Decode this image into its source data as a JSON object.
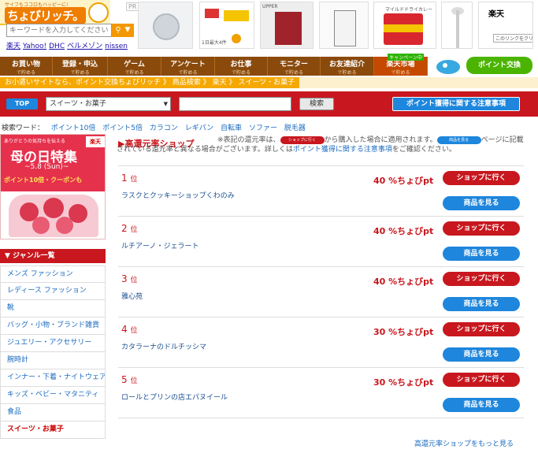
{
  "header": {
    "tagline": "サイフもココロもハッピーに!",
    "brand": "ちょびリッチ。",
    "pr_badge": "PR",
    "search_placeholder": "キーワードを入力してください",
    "quick_links": [
      "楽天",
      "Yahoo!",
      "DHC",
      "ベルメゾン",
      "nissen"
    ],
    "banners": {
      "news_caption": "1日最大4件",
      "shirt_caption": "UPPER",
      "can_caption": "マイルドドライカレー",
      "rakuten_caption": "楽天",
      "rakuten_button": "このリンクをクリック"
    }
  },
  "nav": {
    "items": [
      {
        "label": "お買い物",
        "sub": "で貯める"
      },
      {
        "label": "登録・申込",
        "sub": "で貯める"
      },
      {
        "label": "ゲーム",
        "sub": "で貯める"
      },
      {
        "label": "アンケート",
        "sub": "で貯める"
      },
      {
        "label": "お仕事",
        "sub": "で貯める"
      },
      {
        "label": "モニター",
        "sub": "で貯める"
      },
      {
        "label": "お友達紹介",
        "sub": "で貯める"
      },
      {
        "label": "楽天市場",
        "sub": "で貯める",
        "badge": "キャンペーン中"
      }
    ],
    "point_exchange": "ポイント交換"
  },
  "breadcrumb": {
    "text": "お小遣いサイトなら、ポイント交換ちょびリッチ",
    "items": [
      "商品検索",
      "楽天",
      "スイーツ・お菓子"
    ],
    "separator": "》"
  },
  "search": {
    "top_label": "TOP",
    "category": "スイーツ・お菓子",
    "keyword_value": "",
    "button_label": "検索",
    "notice_button": "ポイント獲得に関する注意事項"
  },
  "keywords": {
    "label": "検索ワード：",
    "items": [
      "ポイント10倍",
      "ポイント5倍",
      "カラコン",
      "レギパン",
      "自転車",
      "ソファー",
      "脱毛器"
    ]
  },
  "promo": {
    "small": "ありがとうの気持ちを伝える",
    "rakuten_badge": "楽天",
    "title": "母の日特集",
    "date": "~5.8 (Sun)~",
    "points": "ポイント10倍・クーポンも"
  },
  "genre": {
    "heading": "▼ ジャンル一覧",
    "items": [
      "メンズ ファッション",
      "レディース ファッション",
      "靴",
      "バッグ・小物・ブランド雑貨",
      "ジュエリー・アクセサリー",
      "腕時計",
      "インナー・下着・ナイトウェア",
      "キッズ・ベビー・マタニティ",
      "食品",
      "スイーツ・お菓子"
    ],
    "active_index": 9
  },
  "section": {
    "title": "▶高還元率ショップ",
    "note_a": "※表記の還元率は、",
    "note_pill": "ショップに行く",
    "note_b": "から購入した場合に適用されます。",
    "note_pill2": "商品を見る",
    "note_c": "ページに記載されている還元率と異なる場合がございます。詳しくは",
    "note_link": "ポイント獲得に関する注意事項",
    "note_d": "をご確認ください。"
  },
  "ranking": [
    {
      "pos": "1",
      "unit": "位",
      "shop": "ラスクとクッキーショップくわのみ",
      "rate": "40 %ちょびpt"
    },
    {
      "pos": "2",
      "unit": "位",
      "shop": "ルチアーノ・ジェラート",
      "rate": "40 %ちょびpt"
    },
    {
      "pos": "3",
      "unit": "位",
      "shop": "雅心苑",
      "rate": "40 %ちょびpt"
    },
    {
      "pos": "4",
      "unit": "位",
      "shop": "カタラーナのドルチッシマ",
      "rate": "30 %ちょびpt"
    },
    {
      "pos": "5",
      "unit": "位",
      "shop": "ロールとプリンの店エパヌイール",
      "rate": "30 %ちょびpt"
    }
  ],
  "buttons": {
    "go_shop": "ショップに行く",
    "view_items": "商品を見る"
  },
  "more_link": "高還元率ショップをもっと見る"
}
